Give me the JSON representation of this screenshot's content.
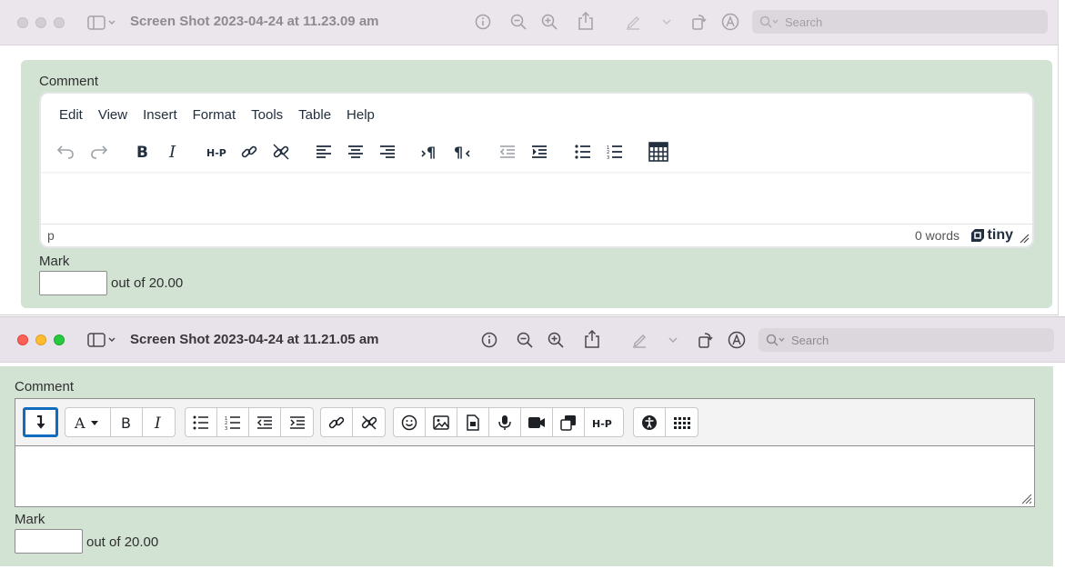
{
  "window1": {
    "title": "Screen Shot 2023-04-24 at 11.23.09 am",
    "search_placeholder": "Search",
    "comment_label": "Comment",
    "menu": [
      "Edit",
      "View",
      "Insert",
      "Format",
      "Tools",
      "Table",
      "Help"
    ],
    "status_path": "p",
    "word_count": "0 words",
    "brand": "tiny",
    "mark_label": "Mark",
    "out_of": "out of 20.00",
    "toolbar_icons": [
      "undo-icon",
      "redo-icon",
      "bold-icon",
      "italic-icon",
      "h5p-icon",
      "link-icon",
      "unlink-icon",
      "align-left-icon",
      "align-center-icon",
      "align-right-icon",
      "ltr-icon",
      "rtl-icon",
      "outdent-icon",
      "indent-icon",
      "bullet-list-icon",
      "numbered-list-icon",
      "table-icon"
    ]
  },
  "window2": {
    "title": "Screen Shot 2023-04-24 at 11.21.05 am",
    "search_placeholder": "Search",
    "comment_label": "Comment",
    "mark_label": "Mark",
    "out_of": "out of 20.00",
    "toolbar_icons": [
      "show-more-icon",
      "font-style-icon",
      "bold-icon",
      "italic-icon",
      "bullet-list-icon",
      "numbered-list-icon",
      "outdent-icon",
      "indent-icon",
      "link-icon",
      "unlink-icon",
      "emoji-icon",
      "image-icon",
      "media-file-icon",
      "record-audio-icon",
      "record-video-icon",
      "manage-files-icon",
      "h5p-icon",
      "accessibility-icon",
      "equation-table-icon"
    ]
  },
  "colors": {
    "panel_bg": "#d2e3d4",
    "titlebar_bg": "#ebe6ec",
    "focus_ring": "#0f6cbf"
  }
}
